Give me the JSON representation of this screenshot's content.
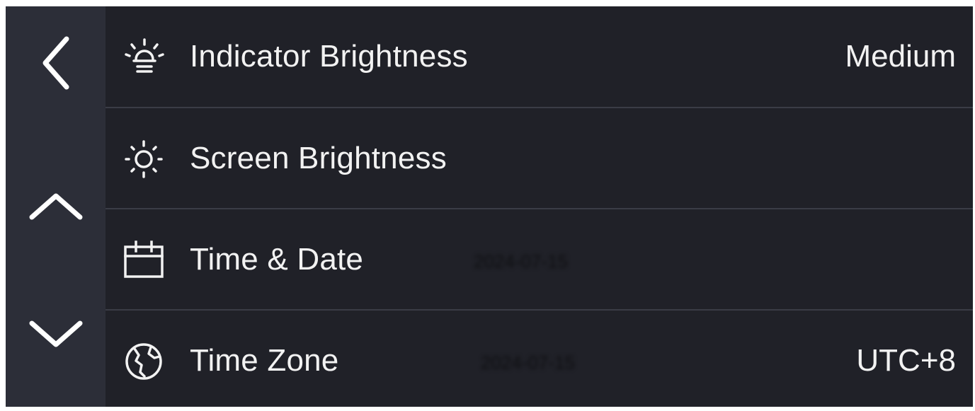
{
  "nav": {
    "back": "chevron-left-icon",
    "up": "chevron-up-icon",
    "down": "chevron-down-icon"
  },
  "rows": [
    {
      "icon": "indicator-lamp-icon",
      "label": "Indicator Brightness",
      "value": "Medium"
    },
    {
      "icon": "sun-icon",
      "label": "Screen Brightness",
      "value": ""
    },
    {
      "icon": "calendar-icon",
      "label": "Time & Date",
      "value": "",
      "obscured": "2024-07-15"
    },
    {
      "icon": "globe-icon",
      "label": "Time Zone",
      "value": "UTC+8",
      "obscured": "2024-07-15"
    }
  ],
  "colors": {
    "background": "#202128",
    "nav_background": "#2c2e38",
    "divider": "#3a3c46",
    "text": "#f2f2f2"
  }
}
